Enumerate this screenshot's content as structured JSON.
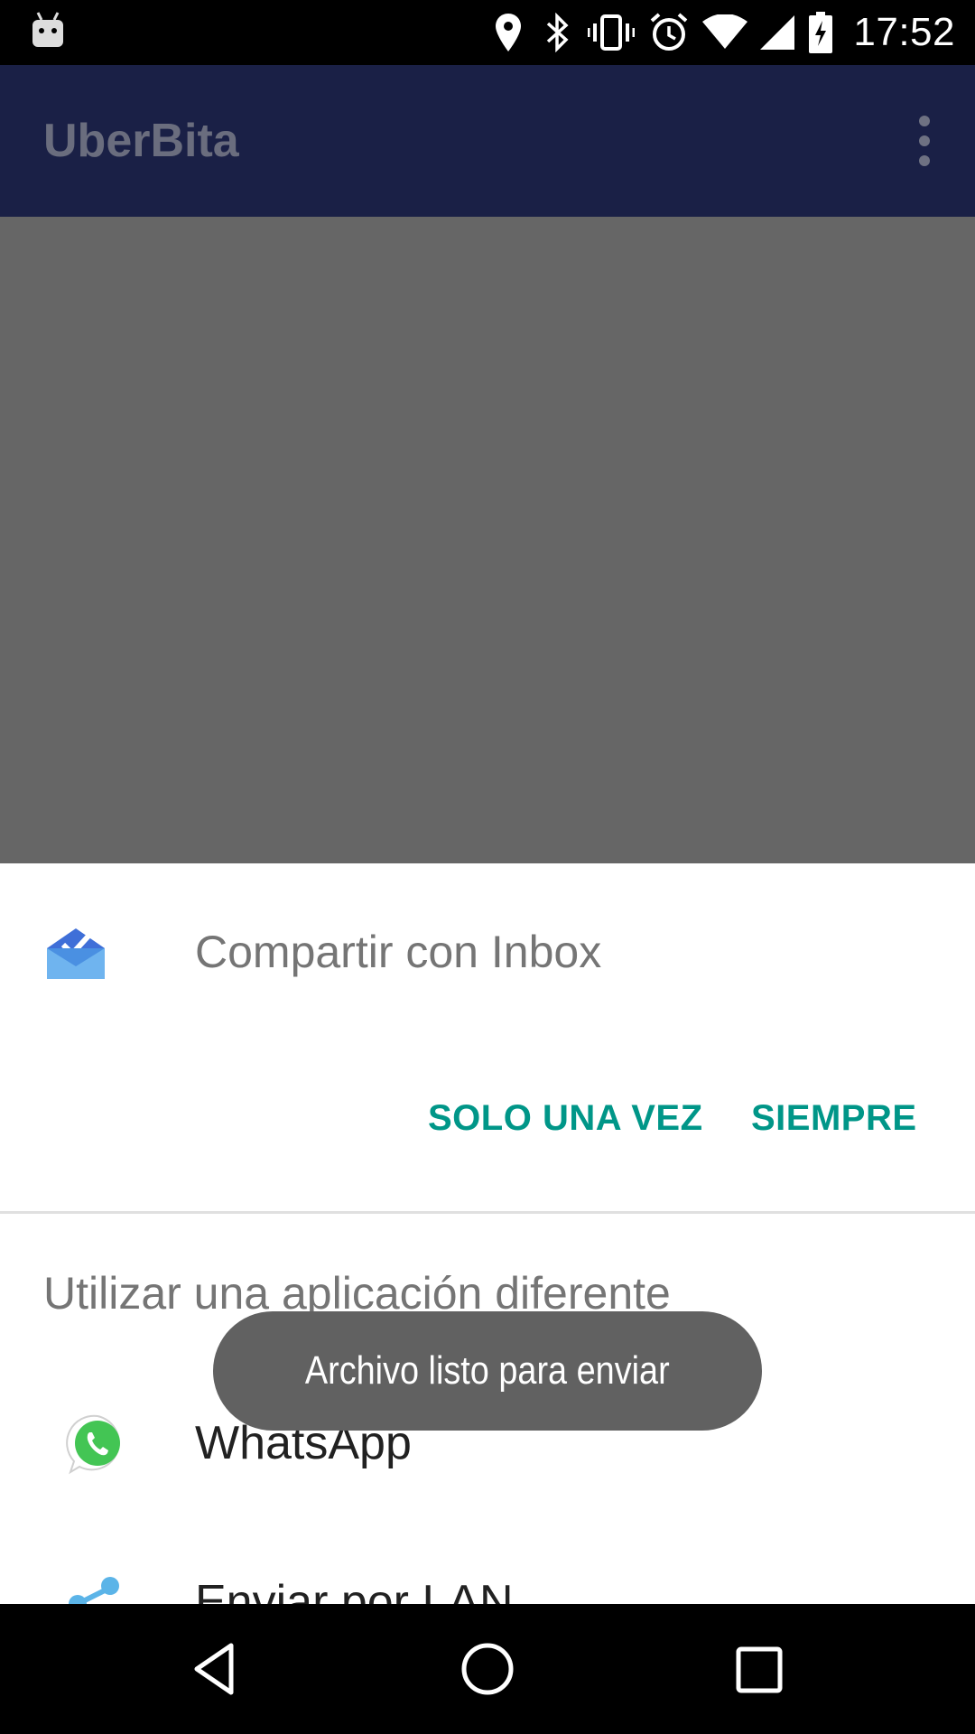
{
  "status_bar": {
    "time": "17:52",
    "icons": [
      "android-debug-icon",
      "location-icon",
      "bluetooth-icon",
      "vibrate-icon",
      "alarm-icon",
      "wifi-icon",
      "cell-signal-icon",
      "battery-charging-icon"
    ]
  },
  "app_bar": {
    "title": "UberBita",
    "menu_icon": "overflow-menu-icon"
  },
  "share_sheet": {
    "default_app_title": "Compartir con Inbox",
    "default_app_icon": "inbox-icon",
    "just_once_label": "SOLO UNA VEZ",
    "always_label": "SIEMPRE",
    "other_apps_label": "Utilizar una aplicación diferente",
    "apps": [
      {
        "label": "WhatsApp",
        "icon": "whatsapp-icon"
      },
      {
        "label": "Enviar por LAN",
        "icon": "share-icon"
      }
    ]
  },
  "toast": {
    "message": "Archivo listo para enviar"
  },
  "nav_bar": {
    "icons": [
      "back-icon",
      "home-icon",
      "recents-icon"
    ]
  },
  "colors": {
    "accent": "#009688",
    "app_bar": "#1a2046",
    "scrim": "#666666"
  }
}
